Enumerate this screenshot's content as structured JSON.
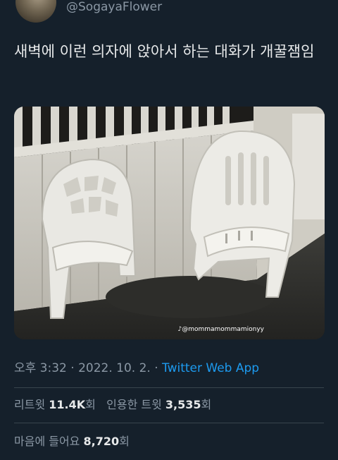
{
  "user": {
    "handle": "@SogayaFlower"
  },
  "tweet": {
    "text": "새벽에 이런 의자에 앉아서 하는 대화가 개꿀잼임"
  },
  "media": {
    "watermark": "♪@mommamommamionyy"
  },
  "meta": {
    "time": "오후 3:32",
    "separator1": " · ",
    "date": "2022. 10. 2.",
    "separator2": " · ",
    "app": "Twitter Web App"
  },
  "stats": {
    "retweets_label": "리트윗",
    "retweets_value": "11.4K",
    "retweets_suffix": "회",
    "quotes_label": "인용한 트윗",
    "quotes_value": "3,535",
    "quotes_suffix": "회",
    "likes_label": "마음에 들어요",
    "likes_value": "8,720",
    "likes_suffix": "회"
  }
}
